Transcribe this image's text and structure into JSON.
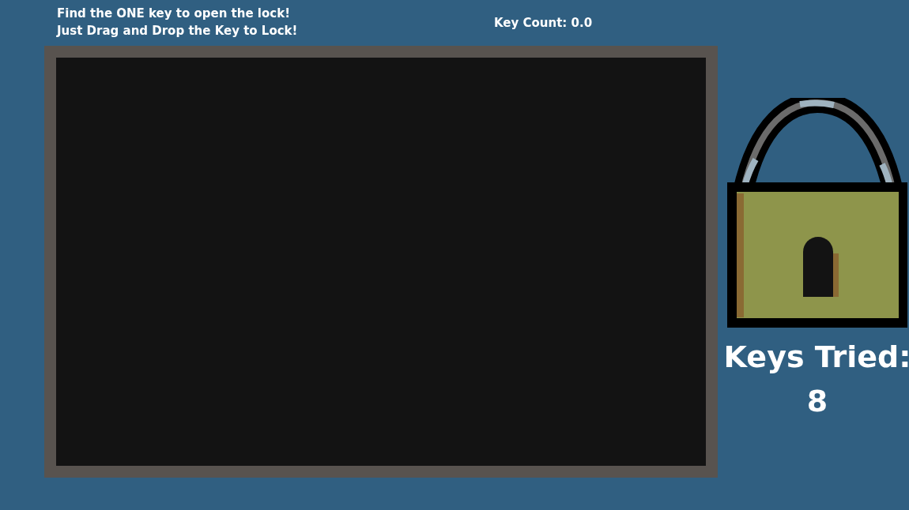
{
  "instructions": [
    "Find the ONE key to open the lock!",
    "Just Drag and Drop the Key to Lock!"
  ],
  "key_count": "Key Count: 0.0",
  "keys_tried": {
    "label": "Keys Tried:",
    "value": "8"
  }
}
